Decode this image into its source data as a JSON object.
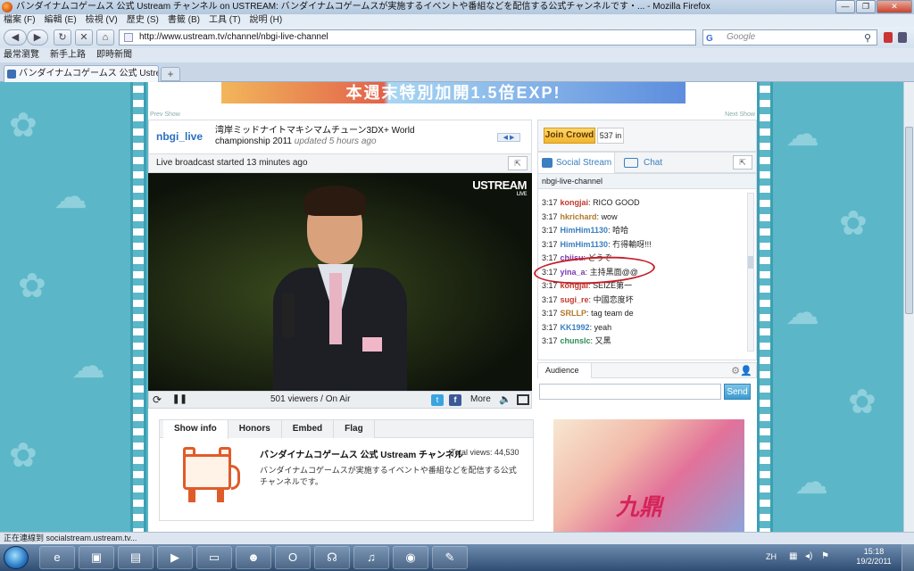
{
  "window": {
    "title": "バンダイナムコゲームス 公式 Ustream チャンネル on USTREAM: バンダイナムコゲームスが実施するイベントや番組などを配信する公式チャンネルです・... - Mozilla Firefox",
    "min": "—",
    "max": "❐",
    "close": "✕"
  },
  "menu": [
    "檔案 (F)",
    "編輯 (E)",
    "檢視 (V)",
    "歷史 (S)",
    "書籤 (B)",
    "工具 (T)",
    "說明 (H)"
  ],
  "nav": {
    "url": "http://www.ustream.tv/channel/nbgi-live-channel",
    "search_placeholder": "Google",
    "back": "◀",
    "forward": "▶",
    "reload": "↻",
    "stop": "✕",
    "home": "⌂"
  },
  "bookmarks": [
    "最常瀏覽",
    "新手上路",
    "即時新聞"
  ],
  "tab": {
    "title": "バンダイナムコゲームス 公式 Ustrea...",
    "new": "+"
  },
  "page": {
    "banner_text": "本週末特別加開1.5倍EXP!",
    "prev_show": "Prev Show",
    "next_show": "Next Show",
    "channel_name": "nbgi_live",
    "show_title": "湾岸ミッドナイトマキシマムチューン3DX+ World championship 2011",
    "updated": "updated 5 hours ago",
    "live_started": "Live broadcast started 13 minutes ago",
    "ustream_logo": "USTREAM",
    "ustream_live": "LIVE",
    "viewers": "501 viewers / On Air",
    "more": "More",
    "join_crowd": "Join Crowd",
    "crowd_count": "537 in",
    "social_stream": "Social Stream",
    "chat": "Chat",
    "chat_channel": "nbgi-live-channel",
    "messages": [
      {
        "time": "3:17",
        "user": "kongjai",
        "text": "RICO GOOD",
        "color": "#c0392b"
      },
      {
        "time": "3:17",
        "user": "hkrichard",
        "text": "wow",
        "color": "#b07a2a"
      },
      {
        "time": "3:17",
        "user": "HimHim1130",
        "text": "哈哈",
        "color": "#3a7fc0"
      },
      {
        "time": "3:17",
        "user": "HimHim1130",
        "text": "冇得輸呀!!!",
        "color": "#3a7fc0"
      },
      {
        "time": "3:17",
        "user": "chiisu",
        "text": "どうぞ",
        "color": "#7a3ab0"
      },
      {
        "time": "3:17",
        "user": "yina_a",
        "text": "主持黑面@@",
        "color": "#7a3ab0"
      },
      {
        "time": "3:17",
        "user": "kongjai",
        "text": "SEIZE第一",
        "color": "#c0392b"
      },
      {
        "time": "3:17",
        "user": "sugi_re",
        "text": "中國恋度坏",
        "color": "#c0392b"
      },
      {
        "time": "3:17",
        "user": "SRLLP",
        "text": "tag team de",
        "color": "#b07a2a"
      },
      {
        "time": "3:17",
        "user": "KK1992",
        "text": "yeah",
        "color": "#3a7fc0"
      },
      {
        "time": "3:17",
        "user": "chunslc",
        "text": "又黑",
        "color": "#2e8b57"
      }
    ],
    "audience": "Audience",
    "send": "Send",
    "info_tabs": [
      "Show info",
      "Honors",
      "Embed",
      "Flag"
    ],
    "info_title": "バンダイナムコゲームス 公式 Ustream チャンネル",
    "total_views": "Total views: 44,530",
    "info_desc": "バンダイナムコゲームスが実施するイベントや番組などを配信する公式チャンネルです。",
    "ad_logo": "九鼎"
  },
  "status": "正在連線到 socialstream.ustream.tv...",
  "taskbar": {
    "lang": "ZH",
    "time": "15:18",
    "date": "19/2/2011"
  }
}
